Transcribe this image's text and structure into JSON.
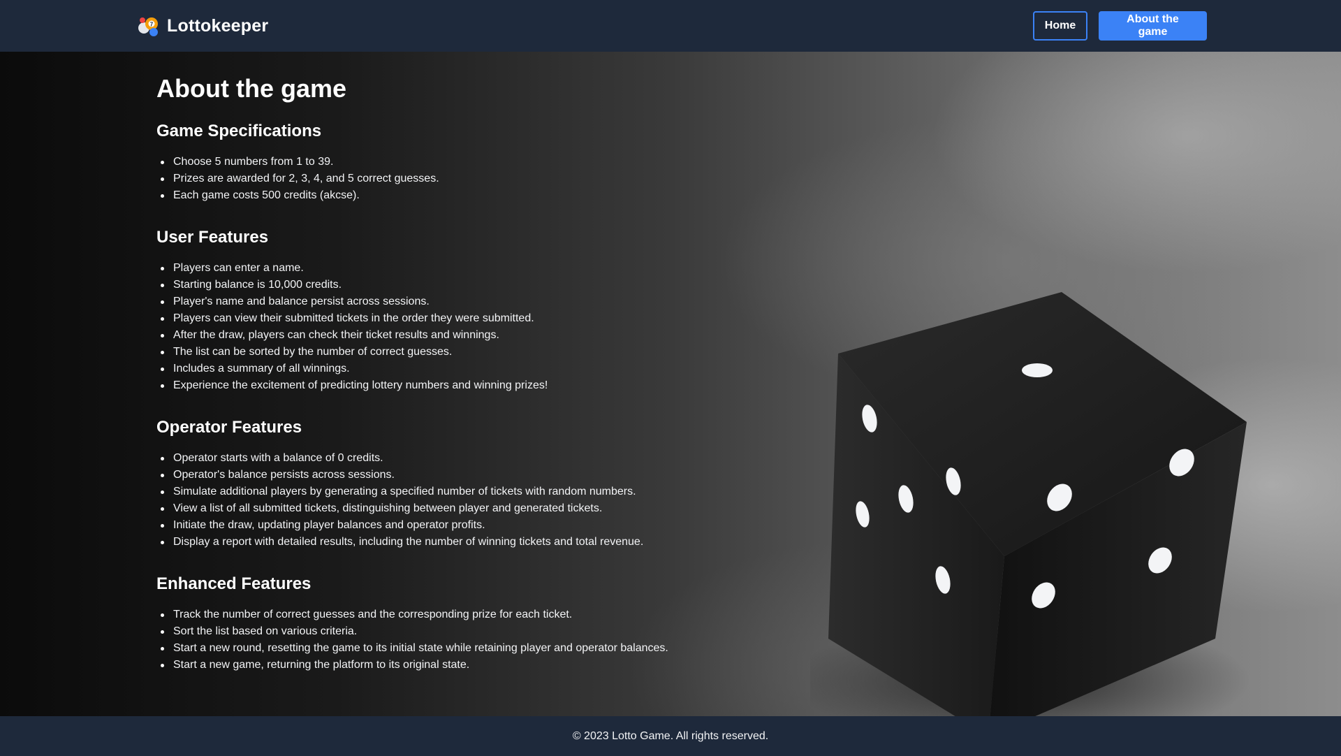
{
  "header": {
    "brand_name": "Lottokeeper",
    "logo_icon": "lottery-balls-icon",
    "nav": {
      "home_label": "Home",
      "about_label": "About the game"
    },
    "colors": {
      "background": "#1e293b",
      "accent": "#3b82f6"
    }
  },
  "main": {
    "title": "About the game",
    "sections": [
      {
        "heading": "Game Specifications",
        "items": [
          "Choose 5 numbers from 1 to 39.",
          "Prizes are awarded for 2, 3, 4, and 5 correct guesses.",
          "Each game costs 500 credits (akcse)."
        ]
      },
      {
        "heading": "User Features",
        "items": [
          "Players can enter a name.",
          "Starting balance is 10,000 credits.",
          "Player's name and balance persist across sessions.",
          "Players can view their submitted tickets in the order they were submitted.",
          "After the draw, players can check their ticket results and winnings.",
          "The list can be sorted by the number of correct guesses.",
          "Includes a summary of all winnings.",
          "Experience the excitement of predicting lottery numbers and winning prizes!"
        ]
      },
      {
        "heading": "Operator Features",
        "items": [
          "Operator starts with a balance of 0 credits.",
          "Operator's balance persists across sessions.",
          "Simulate additional players by generating a specified number of tickets with random numbers.",
          "View a list of all submitted tickets, distinguishing between player and generated tickets.",
          "Initiate the draw, updating player balances and operator profits.",
          "Display a report with detailed results, including the number of winning tickets and total revenue."
        ]
      },
      {
        "heading": "Enhanced Features",
        "items": [
          "Track the number of correct guesses and the corresponding prize for each ticket.",
          "Sort the list based on various criteria.",
          "Start a new round, resetting the game to its initial state while retaining player and operator balances.",
          "Start a new game, returning the platform to its original state."
        ]
      }
    ]
  },
  "footer": {
    "copyright": "© 2023 Lotto Game. All rights reserved."
  }
}
